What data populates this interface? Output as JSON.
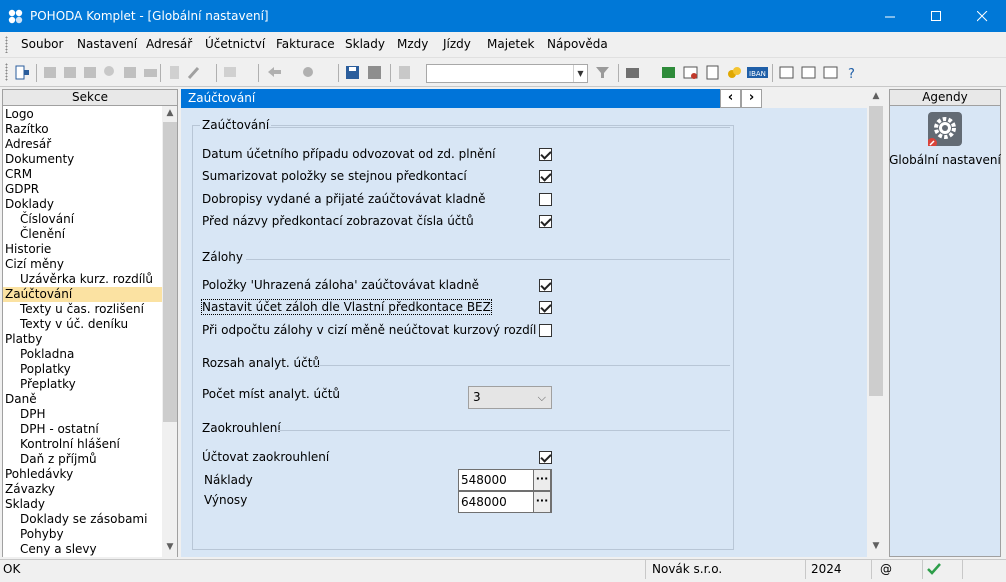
{
  "window": {
    "title": "POHODA Komplet - [Globální nastavení]",
    "accent": "#0078d7"
  },
  "menu": [
    "Soubor",
    "Nastavení",
    "Adresář",
    "Účetnictví",
    "Fakturace",
    "Sklady",
    "Mzdy",
    "Jízdy",
    "Majetek",
    "Nápověda"
  ],
  "left": {
    "header": "Sekce",
    "items": [
      "Logo",
      "Razítko",
      "Adresář",
      "Dokumenty",
      "CRM",
      "GDPR",
      "Doklady",
      "Číslování",
      "Členění",
      "Historie",
      "Cizí měny",
      "Uzávěrka kurz. rozdílů",
      "Zaúčtování",
      "Texty u čas. rozlišení",
      "Texty v úč. deníku",
      "Platby",
      "Pokladna",
      "Poplatky",
      "Přeplatky",
      "Daně",
      "DPH",
      "DPH - ostatní",
      "Kontrolní hlášení",
      "Daň z příjmů",
      "Pohledávky",
      "Závazky",
      "Sklady",
      "Doklady se zásobami",
      "Pohyby",
      "Ceny a slevy"
    ],
    "selected": "Zaúčtování"
  },
  "main": {
    "tab": "Zaúčtování",
    "groups": {
      "zauctovani": "Zaúčtování",
      "zalohy": "Zálohy",
      "rozsah": "Rozsah analyt. účtů",
      "zaokrouhleni": "Zaokrouhlení"
    },
    "options": {
      "datum": {
        "label": "Datum účetního případu odvozovat od zd. plnění",
        "checked": true
      },
      "sumarizovat": {
        "label": "Sumarizovat položky se stejnou předkontací",
        "checked": true
      },
      "dobropisy": {
        "label": "Dobropisy vydané a přijaté zaúčtovávat kladně",
        "checked": false
      },
      "cisla": {
        "label": "Před názvy předkontací zobrazovat čísla účtů",
        "checked": true
      },
      "uhrazena": {
        "label": "Položky 'Uhrazená záloha' zaúčtovávat kladně",
        "checked": true
      },
      "ucet_zaloh": {
        "label": "Nastavit účet záloh dle Vlastní předkontace BEZ",
        "checked": true
      },
      "kurzovy": {
        "label": "Při odpočtu zálohy v cizí měně neúčtovat kurzový rozdíl",
        "checked": false
      },
      "uctovat_zaokr": {
        "label": "Účtovat zaokrouhlení",
        "checked": true
      }
    },
    "pocet_mist": {
      "label": "Počet míst analyt. účtů",
      "value": "3"
    },
    "naklady": {
      "label": "Náklady",
      "value": "548000"
    },
    "vynosy": {
      "label": "Výnosy",
      "value": "648000"
    }
  },
  "right": {
    "header": "Agendy",
    "item": "Globální nastavení"
  },
  "status": {
    "left": "OK",
    "company": "Novák s.r.o.",
    "year": "2024",
    "at": "@"
  }
}
